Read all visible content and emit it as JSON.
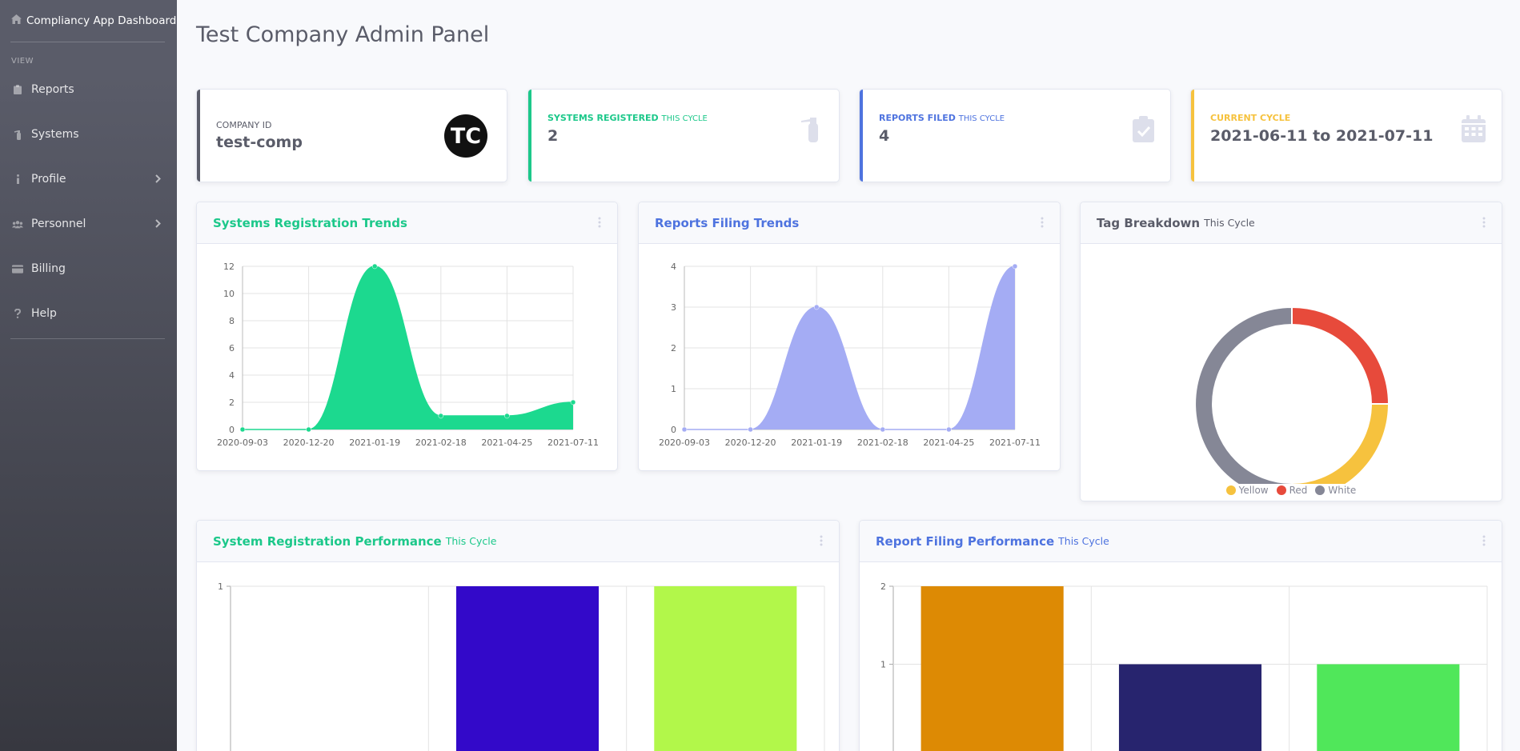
{
  "sidebar": {
    "brand": "Compliancy App Dashboard",
    "heading": "VIEW",
    "items": [
      {
        "label": "Reports",
        "icon": "clipboard-icon"
      },
      {
        "label": "Systems",
        "icon": "fire-extinguisher-icon"
      },
      {
        "label": "Profile",
        "icon": "info-icon",
        "has_submenu": true
      },
      {
        "label": "Personnel",
        "icon": "users-icon",
        "has_submenu": true
      },
      {
        "label": "Billing",
        "icon": "credit-card-icon"
      },
      {
        "label": "Help",
        "icon": "question-icon"
      }
    ]
  },
  "page": {
    "title": "Test Company Admin Panel"
  },
  "stats": [
    {
      "label": "COMPANY ID",
      "sub": "",
      "value": "test-comp",
      "color": "#5a5c69",
      "icon": "company-logo-icon",
      "logo_text": "TC"
    },
    {
      "label": "SYSTEMS REGISTERED",
      "sub": "THIS CYCLE",
      "value": "2",
      "color": "#1cc88a",
      "icon": "fire-extinguisher-icon"
    },
    {
      "label": "REPORTS FILED",
      "sub": "THIS CYCLE",
      "value": "4",
      "color": "#4e73df",
      "icon": "clipboard-check-icon"
    },
    {
      "label": "CURRENT CYCLE",
      "sub": "",
      "value": "2021-06-11 to 2021-07-11",
      "color": "#f6c23e",
      "icon": "calendar-icon"
    }
  ],
  "cards": {
    "systems_trend": {
      "title": "Systems Registration Trends",
      "sub": "",
      "color": "#1cc88a"
    },
    "reports_trend": {
      "title": "Reports Filing Trends",
      "sub": "",
      "color": "#4e73df"
    },
    "tag_breakdown": {
      "title": "Tag Breakdown",
      "sub": "This Cycle",
      "color": "#5a5c69"
    },
    "system_perf": {
      "title": "System Registration Performance",
      "sub": "This Cycle",
      "color": "#1cc88a"
    },
    "report_perf": {
      "title": "Report Filing Performance",
      "sub": "This Cycle",
      "color": "#4e73df"
    }
  },
  "chart_data": [
    {
      "id": "systems_trend",
      "type": "area",
      "x": [
        "2020-09-03",
        "2020-12-20",
        "2021-01-19",
        "2021-02-18",
        "2021-04-25",
        "2021-07-11"
      ],
      "values": [
        0,
        0,
        12,
        1,
        1,
        2
      ],
      "ylim": [
        0,
        12
      ],
      "yticks": [
        0,
        2,
        4,
        6,
        8,
        10,
        12
      ],
      "color": "#1cd98f",
      "grid": true
    },
    {
      "id": "reports_trend",
      "type": "area",
      "x": [
        "2020-09-03",
        "2020-12-20",
        "2021-01-19",
        "2021-02-18",
        "2021-04-25",
        "2021-07-11"
      ],
      "values": [
        0,
        0,
        3,
        0,
        0,
        4
      ],
      "ylim": [
        0,
        4
      ],
      "yticks": [
        0,
        1,
        2,
        3,
        4
      ],
      "color": "#a4acf4",
      "grid": true
    },
    {
      "id": "tag_breakdown",
      "type": "pie",
      "labels": [
        "Yellow",
        "Red",
        "White"
      ],
      "values": [
        1,
        1,
        2
      ],
      "colors": [
        "#f6c23e",
        "#e74a3b",
        "#858796"
      ],
      "legend": "bottom"
    },
    {
      "id": "system_perf",
      "type": "bar",
      "values": [
        0,
        1,
        1
      ],
      "colors": [
        "#ffffff",
        "#3309c9",
        "#b2f74a"
      ],
      "yticks": [
        1
      ],
      "ylim": [
        0,
        1
      ],
      "grid": true
    },
    {
      "id": "report_perf",
      "type": "bar",
      "values": [
        2,
        1,
        1
      ],
      "colors": [
        "#dd8a04",
        "#27246e",
        "#50e75a"
      ],
      "yticks": [
        1,
        2
      ],
      "ylim": [
        0,
        2
      ],
      "grid": true
    }
  ]
}
